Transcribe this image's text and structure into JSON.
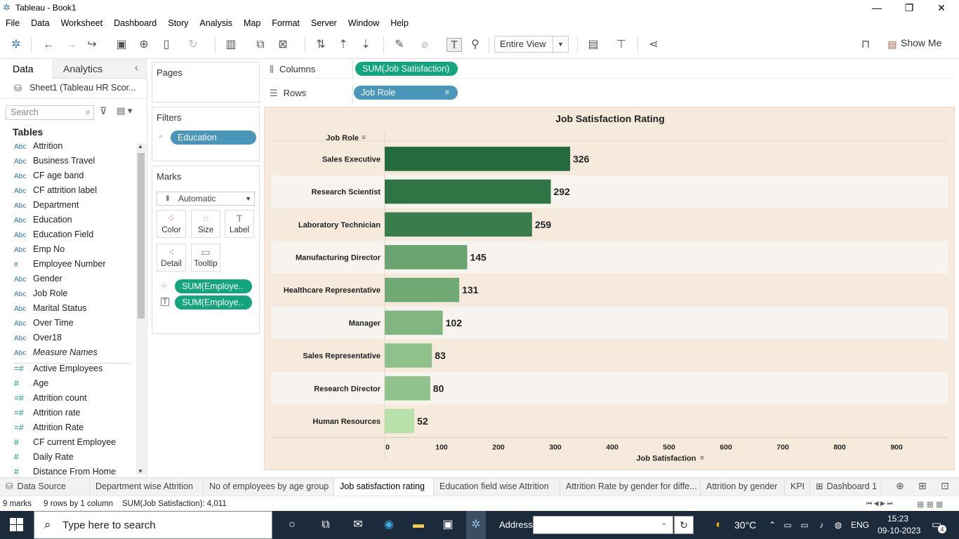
{
  "window": {
    "title": "Tableau - Book1"
  },
  "menu": [
    "File",
    "Data",
    "Worksheet",
    "Dashboard",
    "Story",
    "Analysis",
    "Map",
    "Format",
    "Server",
    "Window",
    "Help"
  ],
  "toolbar": {
    "fit_label": "Entire View",
    "show_me_label": "Show Me"
  },
  "data_pane": {
    "tab_data": "Data",
    "tab_analytics": "Analytics",
    "datasource": "Sheet1 (Tableau HR Scor...",
    "search_placeholder": "Search",
    "tables_heading": "Tables",
    "fields": [
      {
        "type": "Abc",
        "name": "Attrition"
      },
      {
        "type": "Abc",
        "name": "Business Travel"
      },
      {
        "type": "Abc",
        "name": "CF age band"
      },
      {
        "type": "Abc",
        "name": "CF attrition label"
      },
      {
        "type": "Abc",
        "name": "Department"
      },
      {
        "type": "Abc",
        "name": "Education"
      },
      {
        "type": "Abc",
        "name": "Education Field"
      },
      {
        "type": "Abc",
        "name": "Emp No"
      },
      {
        "type": "#",
        "name": "Employee Number"
      },
      {
        "type": "Abc",
        "name": "Gender"
      },
      {
        "type": "Abc",
        "name": "Job Role"
      },
      {
        "type": "Abc",
        "name": "Marital Status"
      },
      {
        "type": "Abc",
        "name": "Over Time"
      },
      {
        "type": "Abc",
        "name": "Over18"
      },
      {
        "type": "Abc",
        "name": "Measure Names"
      }
    ],
    "measures": [
      {
        "type": "=#",
        "name": "Active Employees"
      },
      {
        "type": "#",
        "name": "Age"
      },
      {
        "type": "=#",
        "name": "Attrition count"
      },
      {
        "type": "=#",
        "name": "Attrition rate"
      },
      {
        "type": "=#",
        "name": "Attrition Rate"
      },
      {
        "type": "#",
        "name": "CF current Employee"
      },
      {
        "type": "#",
        "name": "Daily Rate"
      },
      {
        "type": "#",
        "name": "Distance From Home"
      }
    ]
  },
  "cards": {
    "pages": "Pages",
    "filters": "Filters",
    "filter_pill": "Education",
    "marks": "Marks",
    "mark_type": "Automatic",
    "mark_buttons": [
      "Color",
      "Size",
      "Label",
      "Detail",
      "Tooltip"
    ],
    "mark_pills": [
      "SUM(Employe..",
      "SUM(Employe.."
    ]
  },
  "shelves": {
    "columns_label": "Columns",
    "columns_pill": "SUM(Job Satisfaction)",
    "rows_label": "Rows",
    "rows_pill": "Job Role"
  },
  "chart_data": {
    "type": "bar",
    "orientation": "horizontal",
    "title": "Job Satisfaction Rating",
    "row_header": "Job Role",
    "xlabel": "Job Satisfaction",
    "categories": [
      "Sales Executive",
      "Research Scientist",
      "Laboratory Technician",
      "Manufacturing Director",
      "Healthcare Representative",
      "Manager",
      "Sales Representative",
      "Research Director",
      "Human Resources"
    ],
    "values": [
      326,
      292,
      259,
      145,
      131,
      102,
      83,
      80,
      52
    ],
    "xlim": [
      0,
      990
    ],
    "xticks": [
      0,
      100,
      200,
      300,
      400,
      500,
      600,
      700,
      800,
      900
    ],
    "color_scale": {
      "low": "#b7e1a8",
      "high": "#236b3c"
    },
    "background": "#f5eadb"
  },
  "sheet_tabs": [
    {
      "label": "Data Source",
      "active": false
    },
    {
      "label": "Department wise Attrition",
      "active": false
    },
    {
      "label": "No of employees by age group",
      "active": false
    },
    {
      "label": "Job satisfaction rating",
      "active": true
    },
    {
      "label": "Education field wise Attrition",
      "active": false
    },
    {
      "label": "Attrition Rate by gender for diffe...",
      "active": false
    },
    {
      "label": "Attrition by gender",
      "active": false
    },
    {
      "label": "KPI",
      "active": false
    },
    {
      "label": "Dashboard 1",
      "active": false
    }
  ],
  "status": {
    "marks": "9 marks",
    "rows": "9 rows by 1 column",
    "sum": "SUM(Job Satisfaction): 4,011"
  },
  "taskbar": {
    "search_placeholder": "Type here to search",
    "address_label": "Address",
    "temperature": "30°C",
    "lang": "ENG",
    "time": "15:23",
    "date": "09-10-2023",
    "notif_count": "4"
  }
}
